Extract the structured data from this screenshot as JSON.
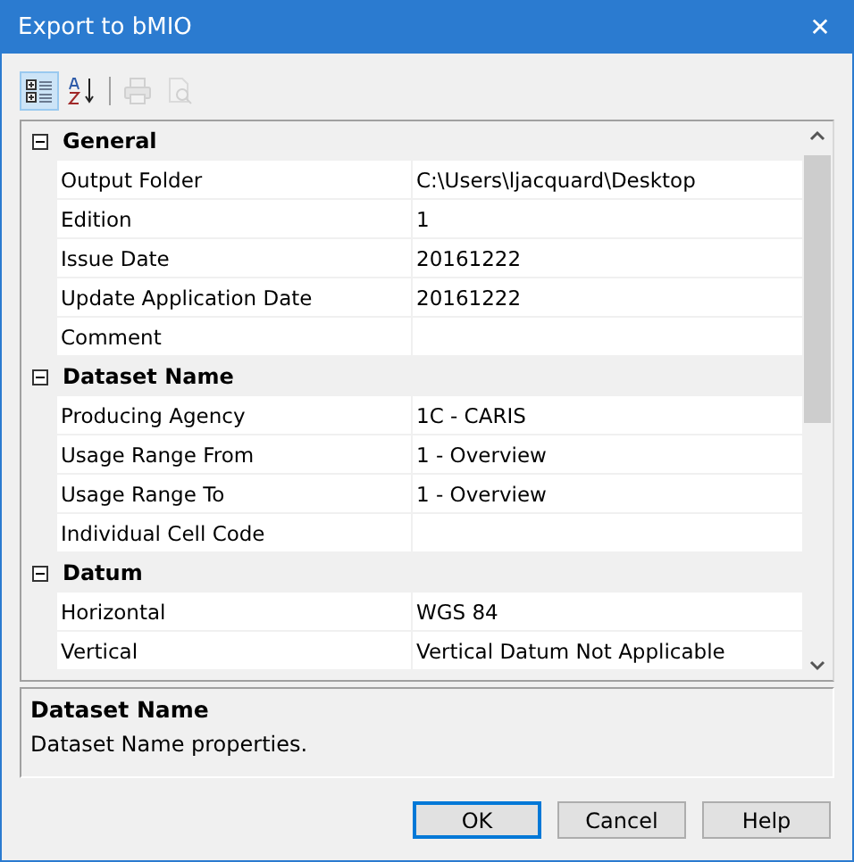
{
  "window": {
    "title": "Export to bMIO",
    "close": "✕"
  },
  "toolbar": [
    {
      "kind": "categorized",
      "selected": true,
      "disabled": false
    },
    {
      "kind": "alphabetical",
      "selected": false,
      "disabled": false
    },
    {
      "kind": "pages",
      "selected": false,
      "disabled": true
    },
    {
      "kind": "preview",
      "selected": false,
      "disabled": true
    }
  ],
  "grid": {
    "categories": [
      {
        "name": "General",
        "expanded": true,
        "properties": [
          {
            "name": "Output Folder",
            "value": "C:\\Users\\ljacquard\\Desktop"
          },
          {
            "name": "Edition",
            "value": "1"
          },
          {
            "name": "Issue Date",
            "value": "20161222"
          },
          {
            "name": "Update Application Date",
            "value": "20161222"
          },
          {
            "name": "Comment"
          }
        ]
      },
      {
        "name": "Dataset Name",
        "expanded": true,
        "properties": [
          {
            "name": "Producing Agency",
            "value": "1C - CARIS"
          },
          {
            "name": "Usage Range From",
            "value": "1 - Overview"
          },
          {
            "name": "Usage Range To",
            "value": "1 - Overview"
          },
          {
            "name": "Individual Cell Code"
          }
        ]
      },
      {
        "name": "Datum",
        "expanded": true,
        "properties": [
          {
            "name": "Horizontal",
            "value": "WGS 84"
          },
          {
            "name": "Vertical",
            "value": "Vertical Datum Not Applicable"
          }
        ]
      }
    ]
  },
  "description": {
    "title": "Dataset Name",
    "text": "Dataset Name properties."
  },
  "buttons": [
    {
      "label": "OK",
      "default": true
    },
    {
      "label": "Cancel",
      "default": false
    },
    {
      "label": "Help",
      "default": false
    }
  ]
}
